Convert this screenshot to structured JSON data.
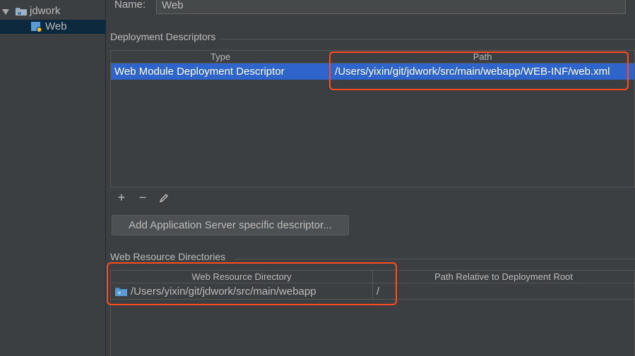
{
  "tree": {
    "root_label": "jdwork",
    "child_label": "Web"
  },
  "name_field": {
    "label": "Name:",
    "value": "Web"
  },
  "deployment": {
    "section_title": "Deployment Descriptors",
    "columns": [
      "Type",
      "Path"
    ],
    "rows": [
      {
        "type": "Web Module Deployment Descriptor",
        "path": "/Users/yixin/git/jdwork/src/main/webapp/WEB-INF/web.xml"
      }
    ],
    "toolbar": {
      "add": "+",
      "remove": "−",
      "edit": "edit-icon"
    },
    "add_server_button": "Add Application Server specific descriptor..."
  },
  "resources": {
    "section_title": "Web Resource Directories",
    "columns": [
      "Web Resource Directory",
      "Path Relative to Deployment Root"
    ],
    "rows": [
      {
        "directory": "/Users/yixin/git/jdwork/src/main/webapp",
        "relative": "/"
      }
    ]
  },
  "colors": {
    "background": "#3c3f41",
    "selection": "#2f65ca",
    "highlight": "#ff4b1f"
  }
}
